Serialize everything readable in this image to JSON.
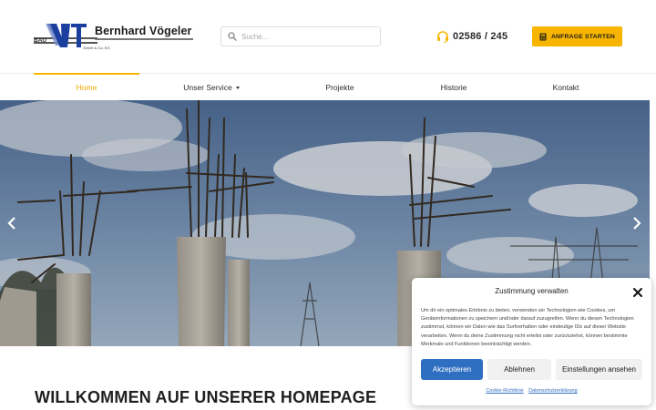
{
  "header": {
    "logo": {
      "name": "Bernhard Vögeler",
      "sub": "GmbH & Co. KG",
      "bau": "BAU"
    },
    "search": {
      "placeholder": "Suche..."
    },
    "phone": "02586 / 245",
    "cta_label": "ANFRAGE STARTEN",
    "accent": "#f7b500"
  },
  "nav": {
    "items": [
      {
        "label": "Home",
        "active": true
      },
      {
        "label": "Unser Service",
        "dropdown": true
      },
      {
        "label": "Projekte"
      },
      {
        "label": "Historie"
      },
      {
        "label": "Kontakt"
      }
    ]
  },
  "slider": {
    "prev_icon": "chevron-left-icon",
    "next_icon": "chevron-right-icon"
  },
  "welcome": {
    "heading": "WILLKOMMEN AUF UNSERER HOMEPAGE"
  },
  "cookie": {
    "title": "Zustimmung verwalten",
    "text": "Um dir ein optimales Erlebnis zu bieten, verwenden wir Technologien wie Cookies, um Geräteinformationen zu speichern und/oder darauf zuzugreifen. Wenn du diesen Technologien zustimmst, können wir Daten wie das Surfverhalten oder eindeutige IDs auf dieser Website verarbeiten. Wenn du deine Zustimmung nicht erteilst oder zurückziehst, können bestimmte Merkmale und Funktionen beeinträchtigt werden.",
    "accept": "Akzeptieren",
    "deny": "Ablehnen",
    "settings": "Einstellungen ansehen",
    "link_cookie": "Cookie-Richtlinie",
    "link_privacy": "Datenschutzerklärung",
    "accept_color": "#2f6fc1"
  }
}
